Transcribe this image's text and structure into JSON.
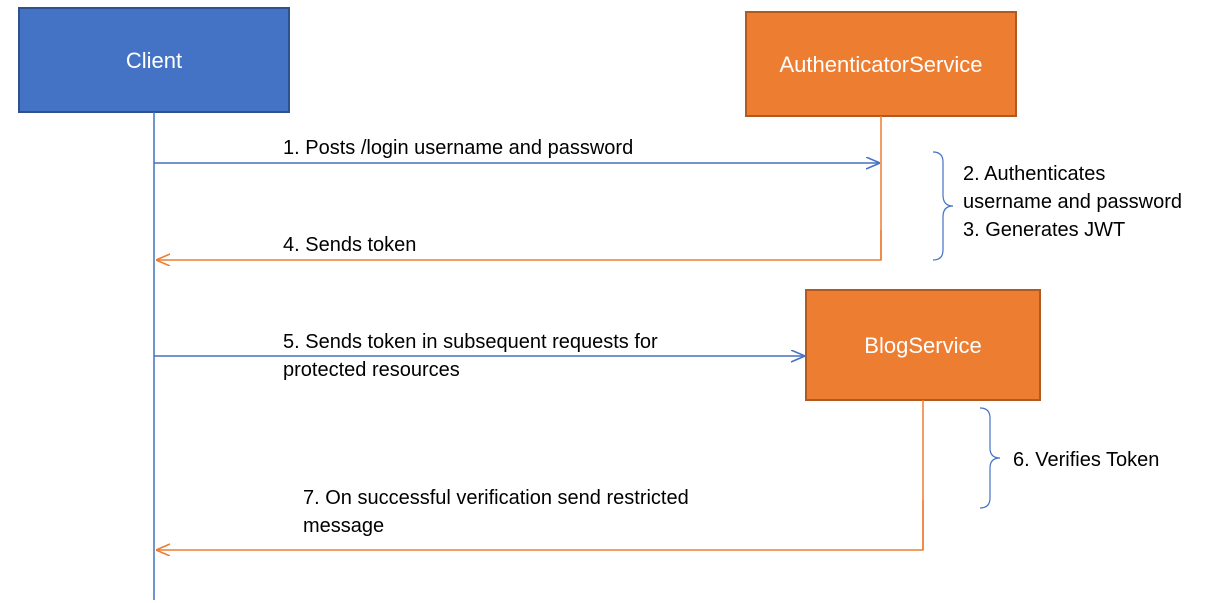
{
  "colors": {
    "client_fill": "#4472c4",
    "client_stroke": "#2f528f",
    "service_fill": "#ed7d31",
    "service_stroke": "#ae5a21",
    "blue_line": "#4472c4",
    "orange_line": "#ed7d31",
    "brace": "#4472c4"
  },
  "boxes": {
    "client": {
      "label": "Client"
    },
    "auth": {
      "label": "AuthenticatorService"
    },
    "blog": {
      "label": "BlogService"
    }
  },
  "messages": {
    "m1": "1. Posts /login username and password",
    "m4": "4. Sends token",
    "m5a": "5. Sends token in subsequent requests for",
    "m5b": "protected resources",
    "m7a": "7. On successful verification send restricted",
    "m7b": "message"
  },
  "notes": {
    "n2": "2. Authenticates",
    "n2b": "username and password",
    "n3": "3. Generates JWT",
    "n6": "6. Verifies Token"
  }
}
